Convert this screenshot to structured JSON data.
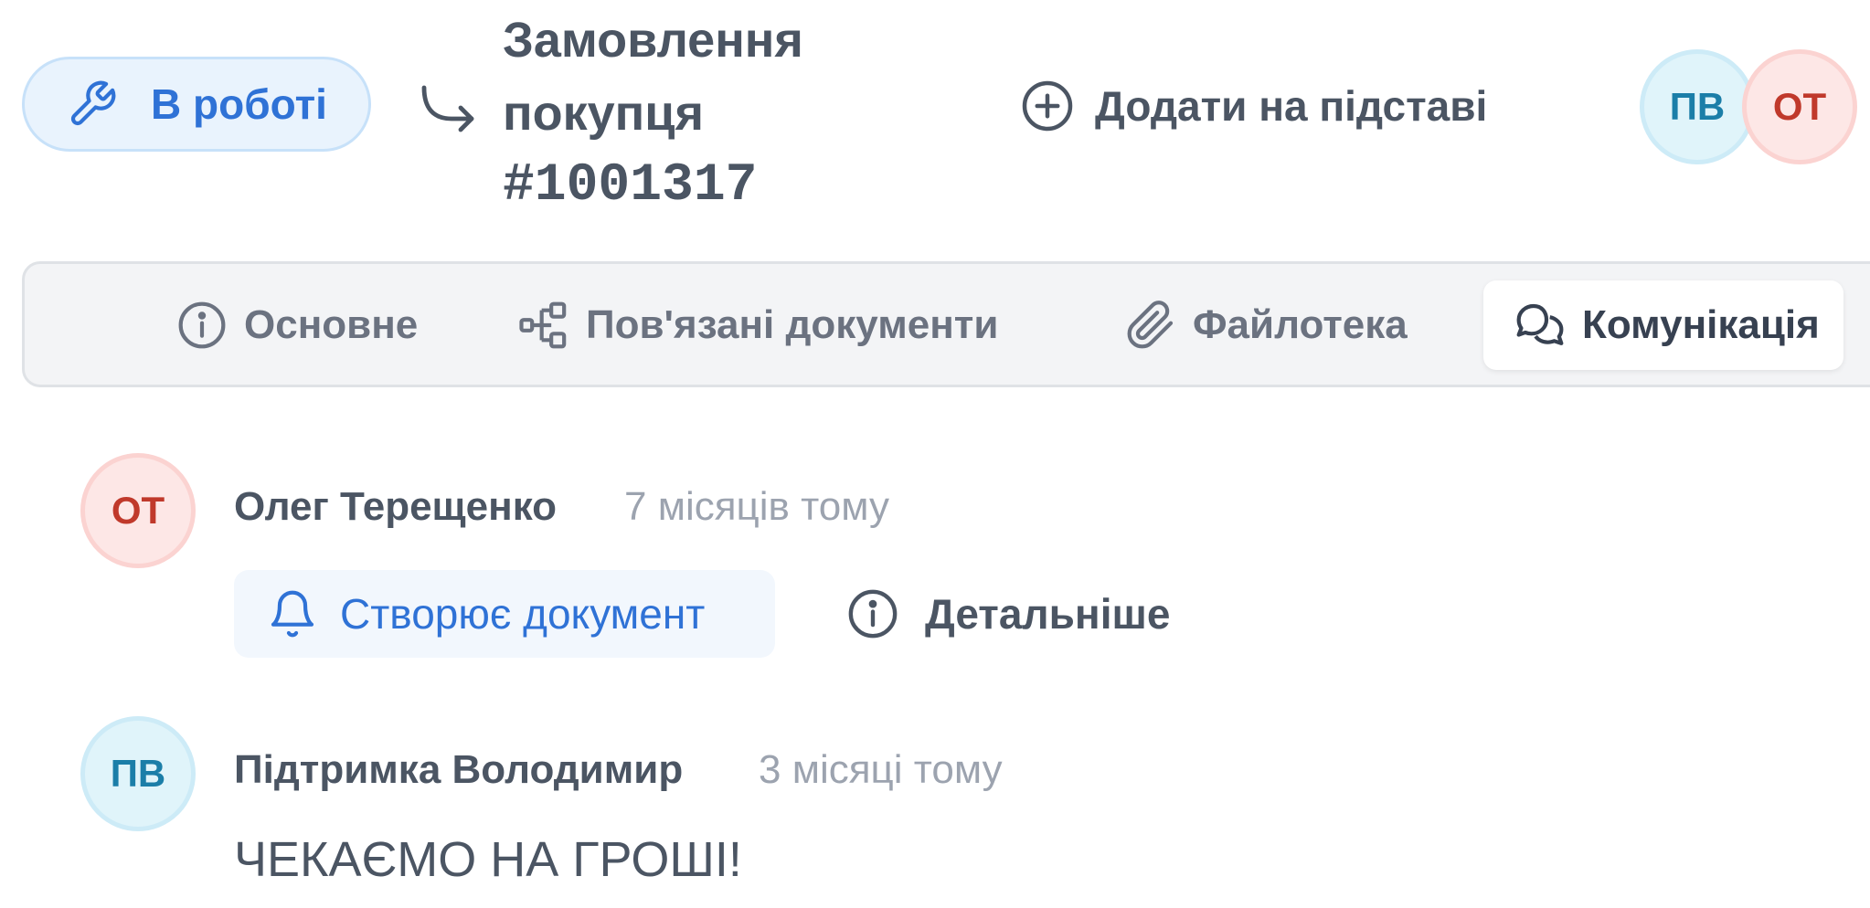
{
  "header": {
    "status_label": "В роботі",
    "title_line1": "Замовлення",
    "title_line2": "покупця",
    "title_number": "#1001317",
    "add_label": "Додати на підставі",
    "participants": [
      {
        "initials": "ПВ",
        "color": "blue"
      },
      {
        "initials": "ОТ",
        "color": "red"
      }
    ]
  },
  "tabs": [
    {
      "label": "Основне",
      "icon": "info-icon",
      "active": false
    },
    {
      "label": "Пов'язані документи",
      "icon": "hierarchy-icon",
      "active": false
    },
    {
      "label": "Файлотека",
      "icon": "paperclip-icon",
      "active": false
    },
    {
      "label": "Комунікація",
      "icon": "chat-icon",
      "active": true
    }
  ],
  "feed": [
    {
      "initials": "ОТ",
      "author": "Олег Терещенко",
      "time": "7 місяців тому",
      "event_label": "Створює документ",
      "details_label": "Детальніше"
    },
    {
      "initials": "ПВ",
      "author": "Підтримка Володимир",
      "time": "3 місяці тому",
      "message": "ЧЕКАЄМО НА ГРОШІ!"
    }
  ],
  "colors": {
    "accent_blue": "#2f72d6",
    "avatar_blue_text": "#1b7ea8",
    "avatar_red_text": "#c0392b",
    "muted": "#9ca3af"
  }
}
